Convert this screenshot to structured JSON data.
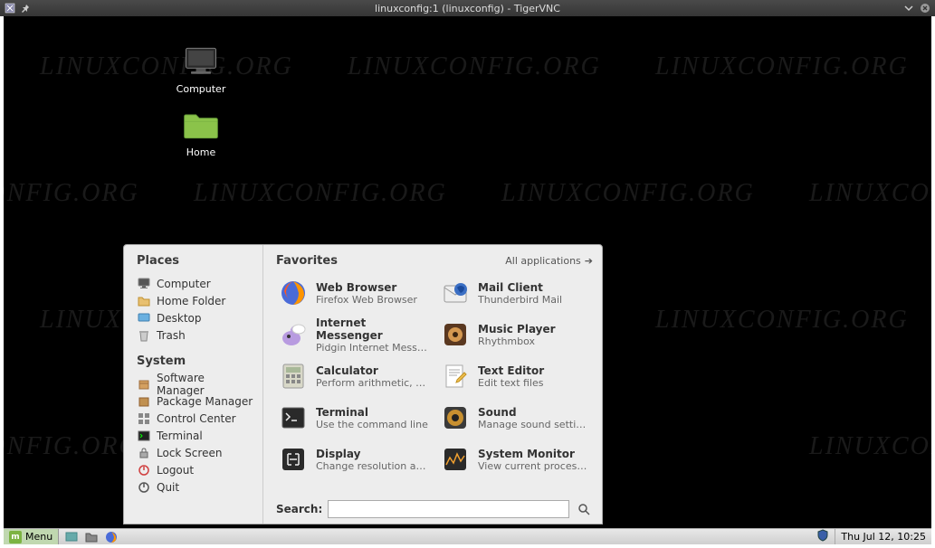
{
  "vnc": {
    "title": "linuxconfig:1 (linuxconfig) - TigerVNC"
  },
  "desktop_icons": {
    "computer": "Computer",
    "home": "Home"
  },
  "watermark": "LINUXCONFIG.ORG",
  "menu": {
    "places_heading": "Places",
    "places": {
      "computer": "Computer",
      "home_folder": "Home Folder",
      "desktop": "Desktop",
      "trash": "Trash"
    },
    "system_heading": "System",
    "system": {
      "software_manager": "Software Manager",
      "package_manager": "Package Manager",
      "control_center": "Control Center",
      "terminal": "Terminal",
      "lock_screen": "Lock Screen",
      "logout": "Logout",
      "quit": "Quit"
    },
    "favorites_heading": "Favorites",
    "all_applications": "All applications",
    "favorites": {
      "web_browser": {
        "title": "Web Browser",
        "desc": "Firefox Web Browser"
      },
      "mail_client": {
        "title": "Mail Client",
        "desc": "Thunderbird Mail"
      },
      "messenger": {
        "title": "Internet Messenger",
        "desc": "Pidgin Internet Messeng..."
      },
      "music": {
        "title": "Music Player",
        "desc": "Rhythmbox"
      },
      "calculator": {
        "title": "Calculator",
        "desc": "Perform arithmetic, scie..."
      },
      "text_editor": {
        "title": "Text Editor",
        "desc": "Edit text files"
      },
      "terminal": {
        "title": "Terminal",
        "desc": "Use the command line"
      },
      "sound": {
        "title": "Sound",
        "desc": "Manage sound settings"
      },
      "display": {
        "title": "Display",
        "desc": "Change resolution and p..."
      },
      "sysmon": {
        "title": "System Monitor",
        "desc": "View current processes ..."
      }
    },
    "search_label": "Search:",
    "search_value": ""
  },
  "panel": {
    "menu_label": "Menu",
    "clock": "Thu Jul 12, 10:25"
  }
}
